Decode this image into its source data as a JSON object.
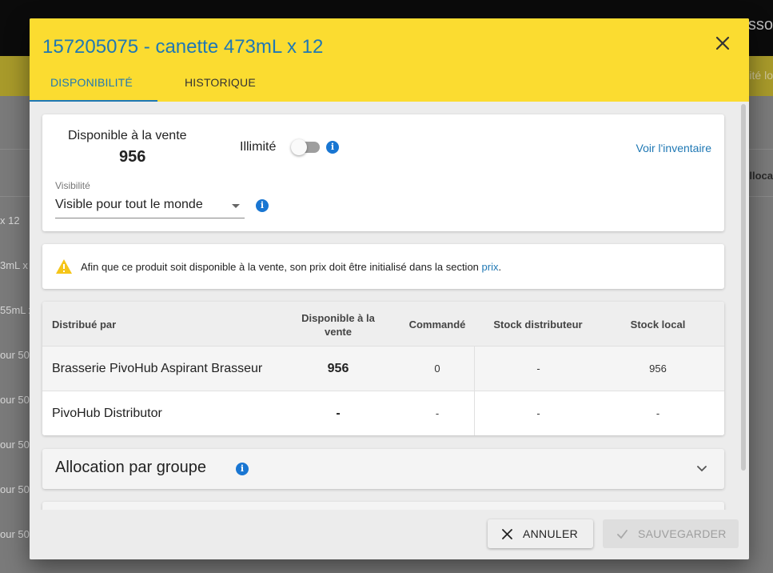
{
  "background": {
    "topbar_partial": "asso",
    "yellowbar_partial": "ité lo",
    "right_header_partial": "lloca",
    "left_rows": [
      "x 12",
      "3mL x",
      "55mL x",
      "our 50",
      "our 50",
      "our 50",
      "our 50",
      "our 50"
    ]
  },
  "dialog": {
    "title": "157205075 - canette 473mL x 12",
    "tabs": [
      {
        "label": "Disponibilité",
        "active": true
      },
      {
        "label": "Historique",
        "active": false
      }
    ],
    "availability": {
      "label": "Disponible à la vente",
      "value": "956",
      "unlimited_label": "Illimité",
      "unlimited_on": false,
      "inventory_link": "Voir l'inventaire"
    },
    "visibility": {
      "label": "Visibilité",
      "value": "Visible pour tout le monde"
    },
    "warning": {
      "text": "Afin que ce produit soit disponible à la vente, son prix doit être initialisé dans la section ",
      "link": "prix",
      "suffix": "."
    },
    "table": {
      "headers": {
        "distributor": "Distribué par",
        "available": "Disponible à la vente",
        "ordered": "Commandé",
        "distributor_stock": "Stock distributeur",
        "local_stock": "Stock local"
      },
      "rows": [
        {
          "distributor": "Brasserie PivoHub Aspirant Brasseur",
          "available": "956",
          "ordered": "0",
          "distributor_stock": "-",
          "local_stock": "956"
        },
        {
          "distributor": "PivoHub Distributor",
          "available": "-",
          "ordered": "-",
          "distributor_stock": "-",
          "local_stock": "-"
        }
      ]
    },
    "allocation": {
      "title": "Allocation par groupe"
    },
    "footer": {
      "cancel_label": "Annuler",
      "save_label": "Sauvegarder"
    }
  },
  "colors": {
    "header_yellow": "#fbdc30",
    "accent_blue": "#1f78b4",
    "info_blue": "#1976d2",
    "warning_yellow": "#f5c518"
  },
  "icons": {
    "close": "close-icon",
    "info": "info-icon",
    "warning": "warning-icon",
    "chevron": "chevron-down-icon",
    "cancel": "x-icon",
    "save": "check-icon"
  }
}
